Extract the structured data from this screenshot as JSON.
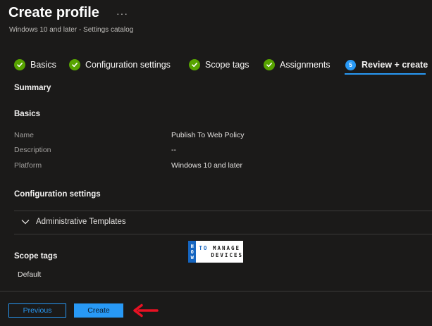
{
  "header": {
    "title": "Create profile",
    "more_label": "···",
    "subtitle": "Windows 10 and later - Settings catalog"
  },
  "wizard": {
    "tabs": [
      {
        "label": "Basics",
        "state": "complete"
      },
      {
        "label": "Configuration settings",
        "state": "complete"
      },
      {
        "label": "Scope tags",
        "state": "complete"
      },
      {
        "label": "Assignments",
        "state": "complete"
      },
      {
        "label": "Review + create",
        "state": "active",
        "step": "5"
      }
    ]
  },
  "summary": {
    "heading": "Summary",
    "basics": {
      "heading": "Basics",
      "rows": [
        {
          "label": "Name",
          "value": "Publish To Web Policy"
        },
        {
          "label": "Description",
          "value": "--"
        },
        {
          "label": "Platform",
          "value": "Windows 10 and later"
        }
      ]
    },
    "configuration": {
      "heading": "Configuration settings",
      "expander_label": "Administrative Templates"
    },
    "scope_tags": {
      "heading": "Scope tags",
      "value": "Default"
    }
  },
  "logo": {
    "how": [
      "H",
      "O",
      "W"
    ],
    "to": "TO",
    "line1": "MANAGE",
    "line2": "DEVICES"
  },
  "footer": {
    "previous_label": "Previous",
    "create_label": "Create"
  },
  "colors": {
    "background": "#1b1a19",
    "accent": "#2899f5",
    "success": "#57a300",
    "annotation_arrow": "#e81123"
  },
  "icons": {
    "complete": "checkmark-circle-icon",
    "expander": "chevron-down-icon",
    "annotation": "arrow-left-icon"
  }
}
